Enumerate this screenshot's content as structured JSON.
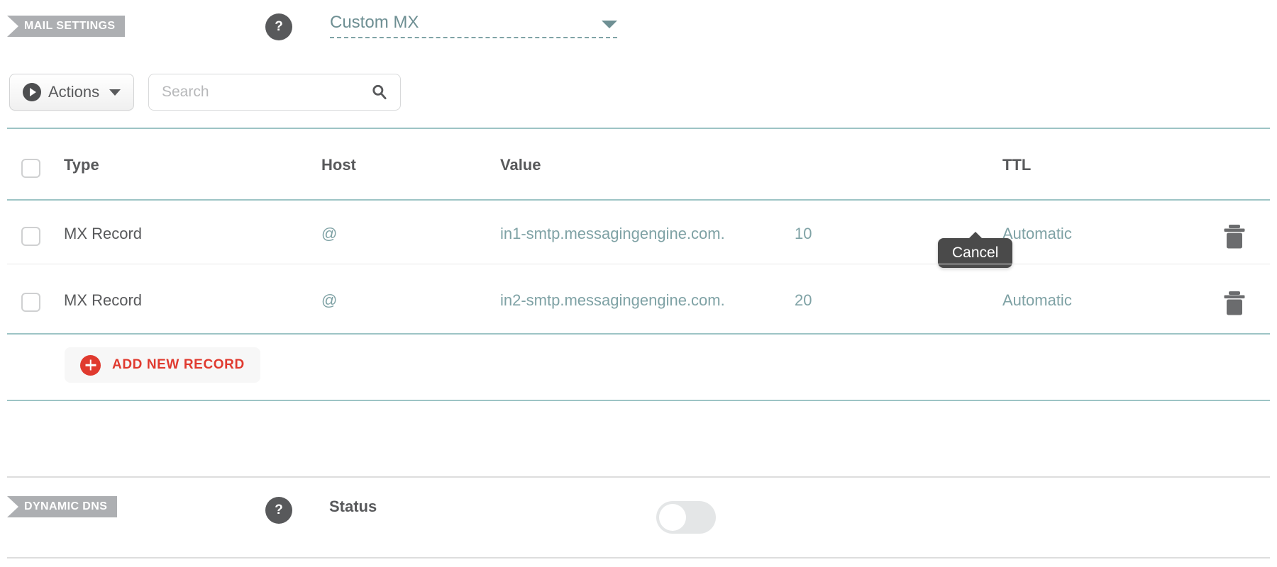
{
  "mail_settings": {
    "badge_label": "MAIL SETTINGS",
    "help_label": "?",
    "mx_mode": {
      "selected": "Custom MX",
      "caret_icon": "chevron-down-icon"
    },
    "toolbar": {
      "actions_label": "Actions",
      "actions_icon": "play-circle-icon",
      "actions_caret_icon": "chevron-down-icon",
      "search_placeholder": "Search",
      "search_value": "",
      "search_icon": "search-icon"
    },
    "table": {
      "columns": [
        "Type",
        "Host",
        "Value",
        "",
        "TTL"
      ],
      "rows": [
        {
          "type": "MX Record",
          "host": "@",
          "value": "in1-smtp.messagingengine.com.",
          "priority": "10",
          "ttl": "Automatic",
          "delete_icon": "trash-icon"
        },
        {
          "type": "MX Record",
          "host": "@",
          "value": "in2-smtp.messagingengine.com.",
          "priority": "20",
          "ttl": "Automatic",
          "delete_icon": "trash-icon"
        }
      ]
    },
    "add_record": {
      "label": "ADD NEW RECORD",
      "icon": "plus-circle-icon"
    },
    "tooltip": {
      "text": "Cancel"
    }
  },
  "dynamic_dns": {
    "badge_label": "DYNAMIC DNS",
    "help_label": "?",
    "status_label": "Status",
    "toggle_state": "off"
  },
  "colors": {
    "accent_teal": "#7fa2a5",
    "rule_teal": "#9dc4c5",
    "badge_gray": "#adafb2",
    "text_gray": "#58595b",
    "danger_red": "#e03a2f",
    "tooltip_dark": "#4a4a4a",
    "toggle_off": "#e4e6e7"
  }
}
